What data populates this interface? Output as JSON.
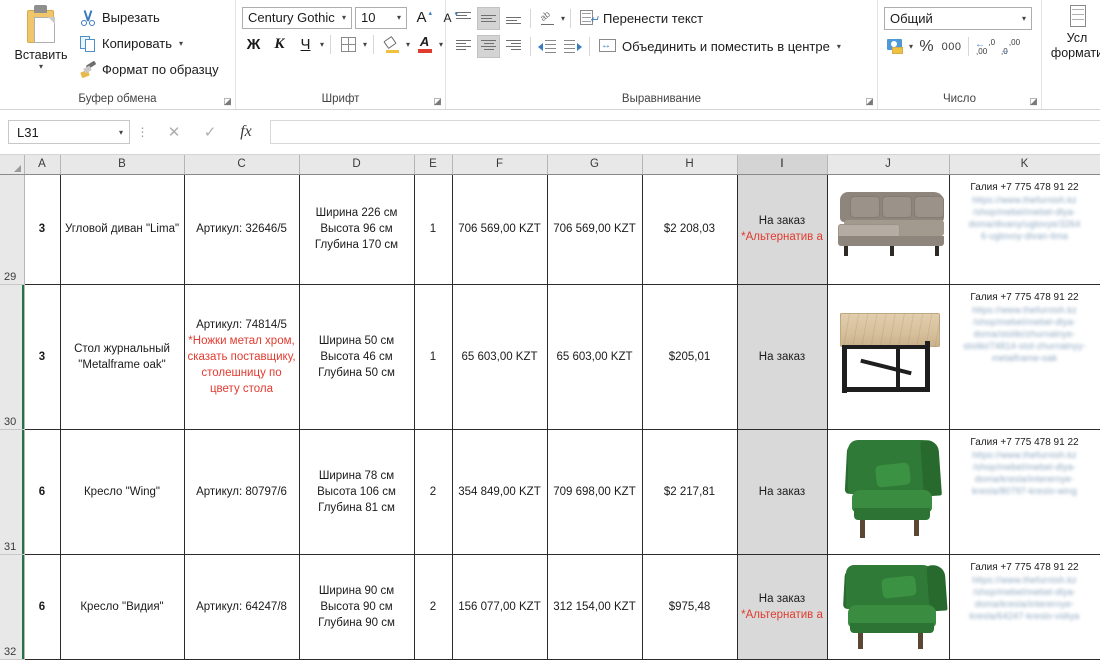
{
  "ribbon": {
    "clipboard": {
      "group_label": "Буфер обмена",
      "paste_label": "Вставить",
      "cut_label": "Вырезать",
      "copy_label": "Копировать",
      "format_painter_label": "Формат по образцу"
    },
    "font": {
      "group_label": "Шрифт",
      "font_name": "Century Gothic",
      "font_size": "10",
      "bold_label": "Ж",
      "italic_label": "К",
      "underline_label": "Ч",
      "grow_label": "A",
      "shrink_label": "A",
      "font_color": "#e03b2f"
    },
    "alignment": {
      "group_label": "Выравнивание",
      "wrap_text_label": "Перенести текст",
      "merge_center_label": "Объединить и поместить в центре"
    },
    "number": {
      "group_label": "Число",
      "format_value": "Общий",
      "percent_label": "%",
      "thousands_label": "000"
    },
    "styles": {
      "conditional_line1": "Усл",
      "conditional_line2": "формати"
    }
  },
  "formula_bar": {
    "name_box_value": "L31",
    "formula_value": "",
    "cancel_icon": "✕",
    "enter_icon": "✓",
    "fx_label": "fx"
  },
  "grid": {
    "columns": [
      "A",
      "B",
      "C",
      "D",
      "E",
      "F",
      "G",
      "H",
      "I",
      "J",
      "K"
    ],
    "selected_column": "I",
    "row_numbers": [
      "29",
      "30",
      "31",
      "32"
    ],
    "rows": [
      {
        "row_number": "29",
        "selected": false,
        "qty_a": "3",
        "name": "Угловой диван \"Lima\"",
        "article": "Артикул: 32646/5",
        "article_note": "",
        "dims": [
          "Ширина 226 см",
          "Высота 96 см",
          "Глубина 170 см"
        ],
        "count": "1",
        "price_unit": "706 569,00 KZT",
        "price_total": "706 569,00 KZT",
        "price_usd": "$2 208,03",
        "status": "На заказ",
        "status_note": "*Альтернатив а",
        "image": "sofa-grey",
        "contact": "Галия +7 775 478 91 22",
        "link_lines": [
          "https://www.thefurnish.kz",
          "/shop/mebel/mebel-dlya-doma/divany/uglovye/3264",
          "6-uglovoy-divan-lima"
        ]
      },
      {
        "row_number": "30",
        "selected": true,
        "qty_a": "3",
        "name": "Стол журнальный \"Metalframe oak\"",
        "article": "Артикул: 74814/5",
        "article_note": "*Ножки метал хром, сказать поставщику, столешницу по цвету стола",
        "dims": [
          "Ширина 50 см",
          "Высота 46 см",
          "Глубина 50 см"
        ],
        "count": "1",
        "price_unit": "65 603,00 KZT",
        "price_total": "65 603,00 KZT",
        "price_usd": "$205,01",
        "status": "На заказ",
        "status_note": "",
        "image": "coffee-table-oak",
        "contact": "Галия +7 775 478 91 22",
        "link_lines": [
          "https://www.thefurnish.kz",
          "/shop/mebel/mebel-dlya-doma/stoliki/zhurnalnye-stoliki/74814-stol-zhurnalnyy-metalframe-oak"
        ]
      },
      {
        "row_number": "31",
        "selected": true,
        "qty_a": "6",
        "name": "Кресло \"Wing\"",
        "article": "Артикул: 80797/6",
        "article_note": "",
        "dims": [
          "Ширина 78 см",
          "Высота 106 см",
          "Глубина 81 см"
        ],
        "count": "2",
        "price_unit": "354 849,00 KZT",
        "price_total": "709 698,00 KZT",
        "price_usd": "$2 217,81",
        "status": "На заказ",
        "status_note": "",
        "image": "armchair-green-wing",
        "contact": "Галия +7 775 478 91 22",
        "link_lines": [
          "https://www.thefurnish.kz",
          "/shop/mebel/mebel-dlya-doma/kresla/interernye-kresla/80797-kreslo-wing"
        ]
      },
      {
        "row_number": "32",
        "selected": true,
        "qty_a": "6",
        "name": "Кресло \"Видия\"",
        "article": "Артикул: 64247/8",
        "article_note": "",
        "dims": [
          "Ширина 90 см",
          "Высота 90 см",
          "Глубина 90 см"
        ],
        "count": "2",
        "price_unit": "156 077,00 KZT",
        "price_total": "312 154,00 KZT",
        "price_usd": "$975,48",
        "status": "На заказ",
        "status_note": "*Альтернатив а",
        "image": "armchair-green-vidiya",
        "contact": "Галия +7 775 478 91 22",
        "link_lines": [
          "https://www.thefurnish.kz",
          "/shop/mebel/mebel-dlya-doma/kresla/interernye-kresla/64247-kreslo-vidiya"
        ]
      }
    ]
  },
  "colors": {
    "excel_green": "#217346",
    "note_red": "#e03b2f",
    "status_bg": "#d9d9d9",
    "header_bg": "#e8e8e8"
  }
}
